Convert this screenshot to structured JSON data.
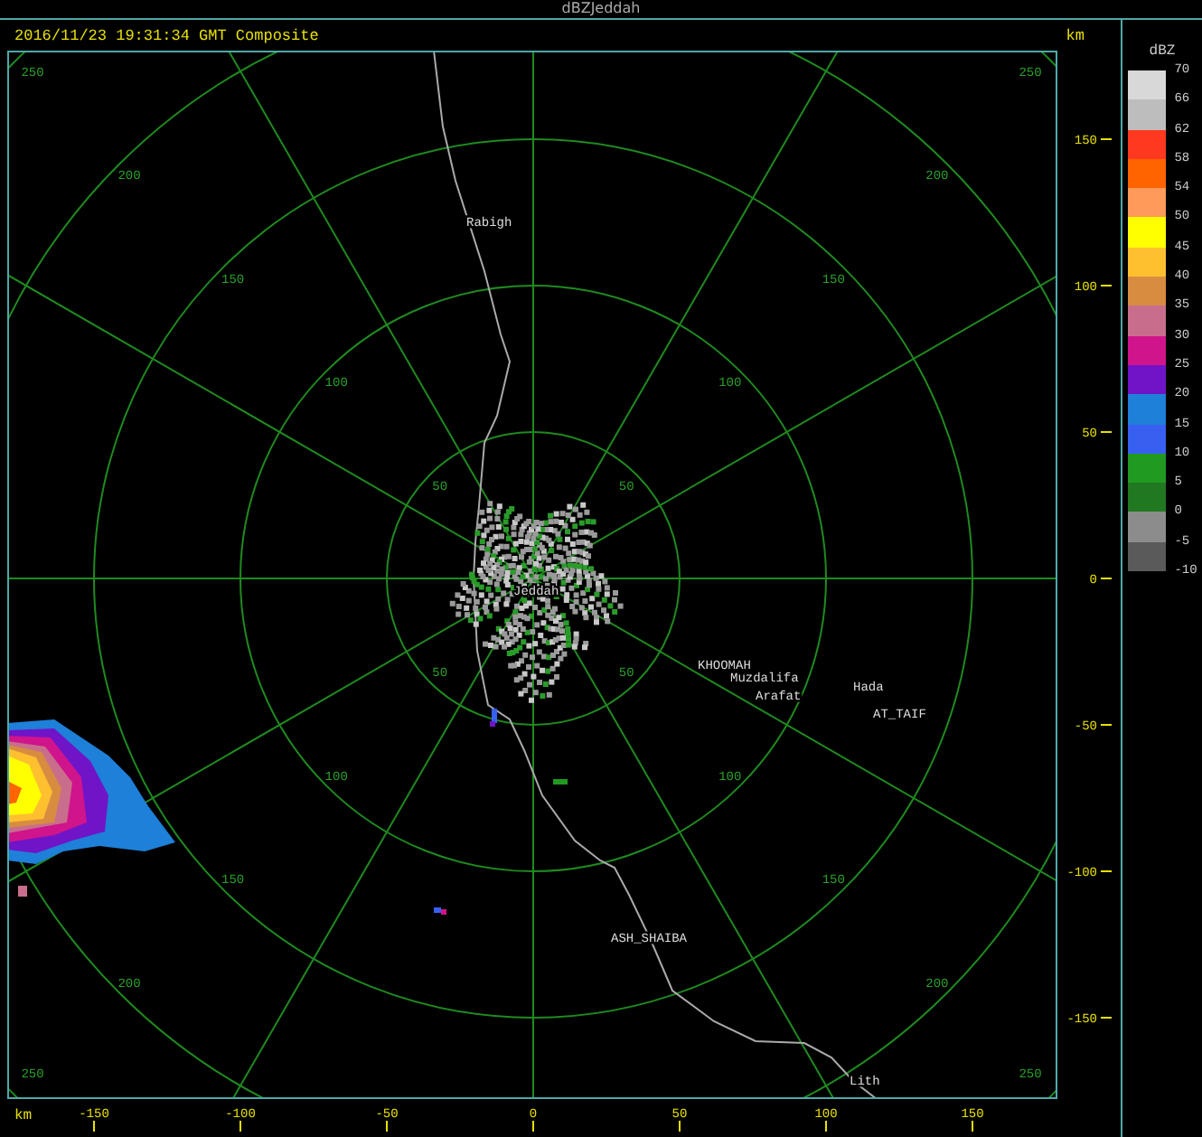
{
  "window": {
    "title": "dBZJeddah"
  },
  "header": {
    "timestamp": "2016/11/23 19:31:34 GMT Composite",
    "unit": "km"
  },
  "rings": [
    {
      "labels": [
        "50",
        "50",
        "50",
        "50"
      ]
    },
    {
      "labels": [
        "100",
        "100",
        "100",
        "100"
      ]
    },
    {
      "labels": [
        "150",
        "150",
        "150",
        "150"
      ]
    },
    {
      "labels": [
        "200",
        "200",
        "200",
        "200"
      ]
    },
    {
      "labels": [
        "250",
        "250",
        "250",
        "250"
      ]
    }
  ],
  "places": [
    "Rabigh",
    "Jeddah",
    "KHOOMAH",
    "Muzdalifa",
    "Arafat",
    "Hada",
    "AT_TAIF",
    "ASH_SHAIBA",
    "Lith"
  ],
  "y_axis": {
    "ticks": [
      "150",
      "100",
      "50",
      "0",
      "-50",
      "-100",
      "-150"
    ]
  },
  "x_axis": {
    "unit": "km",
    "ticks": [
      "-150",
      "-100",
      "-50",
      "0",
      "50",
      "100",
      "150"
    ]
  },
  "legend": {
    "title": "dBZ",
    "bands": [
      {
        "color": "#d8d8d8"
      },
      {
        "color": "#bdbdbd"
      },
      {
        "color": "#ff3820"
      },
      {
        "color": "#ff6400"
      },
      {
        "color": "#ff9a5a"
      },
      {
        "color": "#ffff00"
      },
      {
        "color": "#ffc030"
      },
      {
        "color": "#d88c40"
      },
      {
        "color": "#c86e8c"
      },
      {
        "color": "#d0148c"
      },
      {
        "color": "#7014c8"
      },
      {
        "color": "#1e80d8"
      },
      {
        "color": "#3860f0"
      },
      {
        "color": "#209a20"
      },
      {
        "color": "#207820"
      },
      {
        "color": "#8c8c8c"
      },
      {
        "color": "#5a5a5a"
      }
    ],
    "labels": [
      "70",
      "66",
      "62",
      "58",
      "54",
      "50",
      "45",
      "40",
      "35",
      "30",
      "25",
      "20",
      "15",
      "10",
      "5",
      "0",
      "-5",
      "-10"
    ]
  }
}
